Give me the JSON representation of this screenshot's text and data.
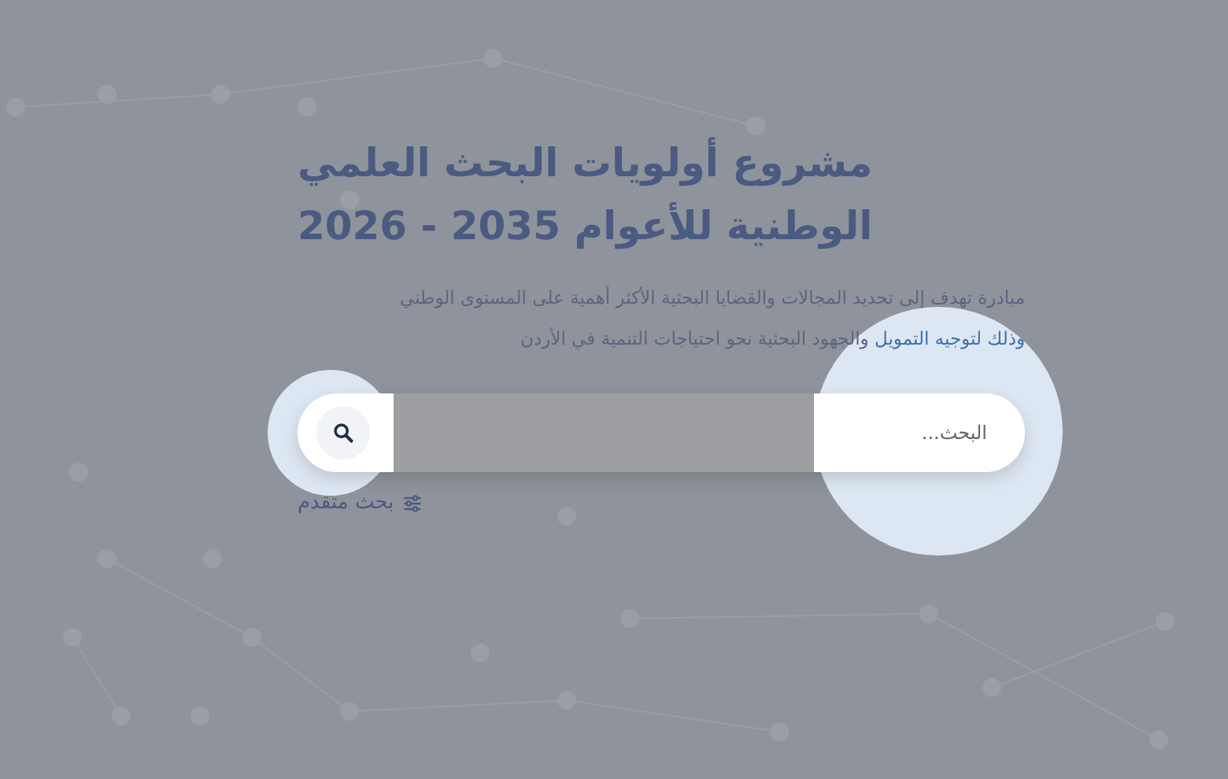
{
  "hero": {
    "title_lines": [
      "مشروع أولويات البحث العلمي",
      "الوطنية للأعوام 2035 - 2026"
    ],
    "description": {
      "link": "وذلك لتوجيه التمويل",
      "text_before": "مبادرة تهدف إلى تحديد المجالات والقضايا البحثية الأكثر أهمية على المستوى الوطني",
      "text_after": "والجهود البحثية نحو احتياجات التنمية في الأردن"
    }
  },
  "search": {
    "placeholder": "البحث..."
  },
  "advanced_search": {
    "label": "بحث متقدم"
  }
}
